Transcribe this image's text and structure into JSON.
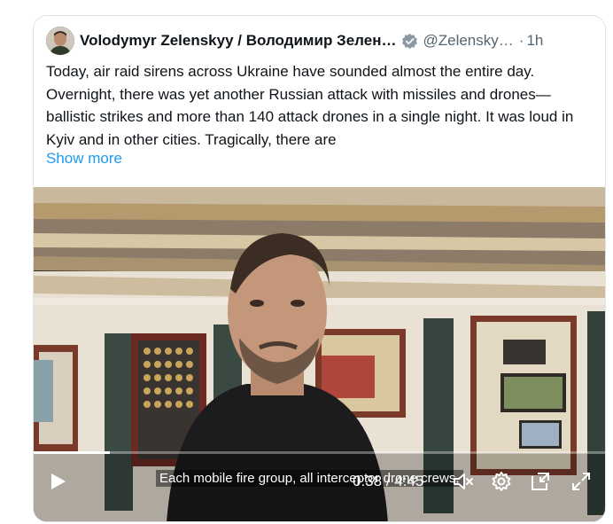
{
  "post": {
    "author_name": "Volodymyr Zelenskyy / Володимир Зелен…",
    "handle": "@Zelensky…",
    "separator": "·",
    "time": "1h",
    "text": "Today, air raid sirens across Ukraine have sounded almost the entire day. Overnight, there was yet another Russian attack with missiles and drones—ballistic strikes and more than 140 attack drones in a single night. It was loud in Kyiv and in other cities. Tragically, there are",
    "show_more_label": "Show more"
  },
  "video": {
    "caption": "Each mobile fire group, all interceptor drone crews,",
    "current_time": "0:38",
    "time_separator": " / ",
    "duration": "4:45",
    "progress_fraction": 0.133
  },
  "icons": {
    "verified": "verified-badge-icon",
    "play": "play-icon",
    "mute": "volume-muted-icon",
    "settings": "gear-icon",
    "pip": "picture-in-picture-icon",
    "fullscreen": "fullscreen-icon"
  },
  "colors": {
    "link": "#1d9bf0",
    "text": "#0f1419",
    "secondary": "#536471",
    "border": "#dfe3e6"
  }
}
